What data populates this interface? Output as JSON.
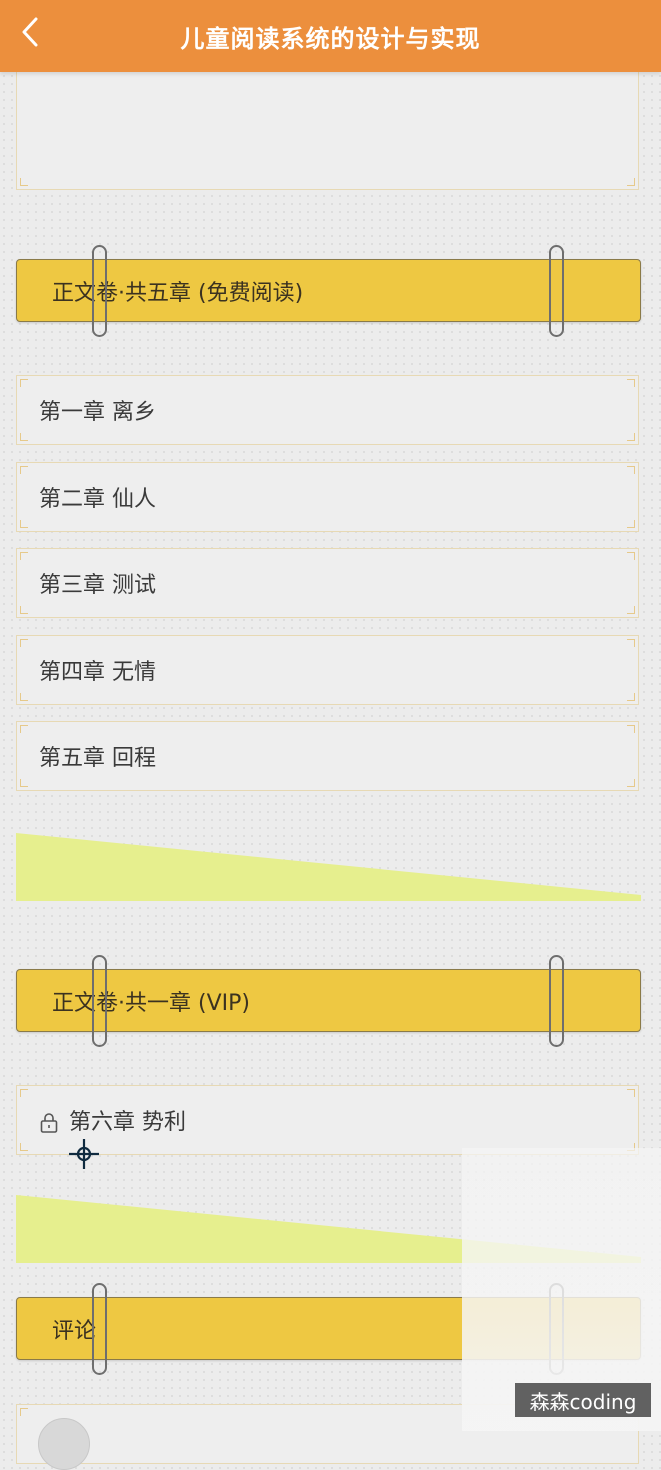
{
  "header": {
    "back_icon": "chevron-left-icon",
    "title": "儿童阅读系统的设计与实现",
    "bg_color": "#ec8f3d"
  },
  "sections": [
    {
      "title": "正文卷·共五章 (免费阅读)",
      "chapters": [
        {
          "title": "第一章 离乡",
          "locked": false
        },
        {
          "title": "第二章 仙人",
          "locked": false
        },
        {
          "title": "第三章 测试",
          "locked": false
        },
        {
          "title": "第四章 无情",
          "locked": false
        },
        {
          "title": "第五章 回程",
          "locked": false
        }
      ]
    },
    {
      "title": "正文卷·共一章 (VIP)",
      "chapters": [
        {
          "title": "第六章 势利",
          "locked": true,
          "icon": "lock-icon"
        }
      ]
    },
    {
      "title": "评论",
      "chapters": []
    }
  ],
  "watermark": "森森coding",
  "colors": {
    "section_bar": "#eec842",
    "accent_wedge": "#e6ef8e"
  }
}
